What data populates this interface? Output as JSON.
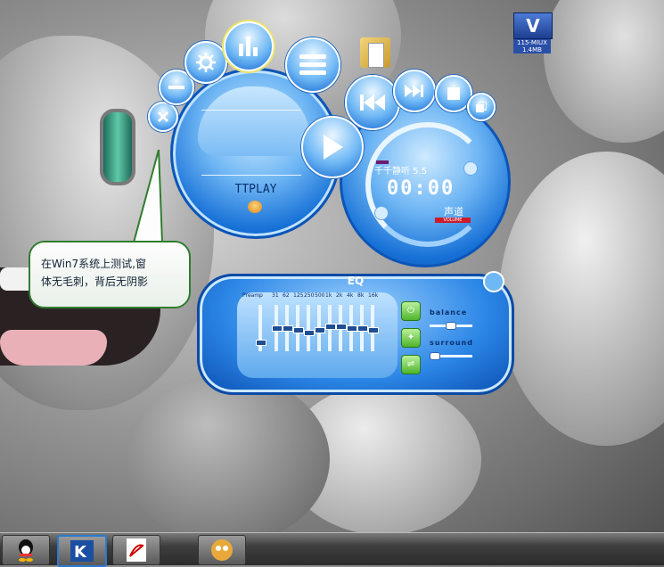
{
  "desktop": {
    "vm_icon_caption": "115-MIUX 1.4MB",
    "vm_icon_glyph": "V"
  },
  "bubble": {
    "line1": "在Win7系统上测试,窗",
    "line2": "体无毛刺，背后无阴影"
  },
  "player": {
    "brand": "TTPLAY",
    "song_title": "千千静听 5.5",
    "time": "00:00",
    "channel_label": "声道",
    "volume_label": "VOLUME",
    "buttons": [
      "close-icon",
      "minimize-icon",
      "settings-icon",
      "equalizer-icon",
      "playlist-icon",
      "play-icon",
      "previous-icon",
      "next-icon",
      "stop-icon",
      "mini-mode-icon"
    ]
  },
  "eq": {
    "title": "EQ",
    "preamp_label": "Preamp",
    "bands": [
      "31",
      "62",
      "125",
      "250",
      "500",
      "1k",
      "2k",
      "4k",
      "8k",
      "16k"
    ],
    "band_levels": [
      0.5,
      0.5,
      0.55,
      0.6,
      0.55,
      0.45,
      0.45,
      0.5,
      0.5,
      0.55
    ],
    "balance_label": "balance",
    "surround_label": "surround"
  },
  "taskbar": {
    "items": [
      "qq-icon",
      "kk-app-icon",
      "pdf-icon",
      "ttplay-icon"
    ]
  },
  "colors": {
    "accent": "#1670d6",
    "bubble_border": "#2f7d2f",
    "taskbar": "#2b2b2b"
  }
}
